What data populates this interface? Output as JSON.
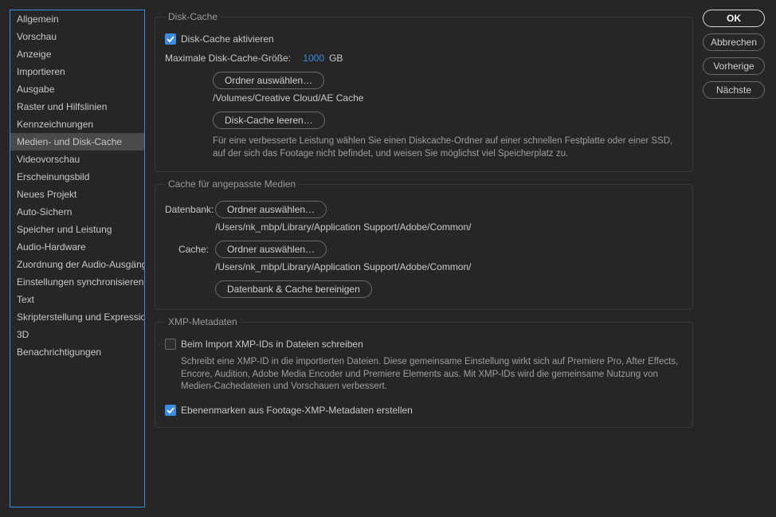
{
  "sidebar": {
    "items": [
      "Allgemein",
      "Vorschau",
      "Anzeige",
      "Importieren",
      "Ausgabe",
      "Raster und Hilfslinien",
      "Kennzeichnungen",
      "Medien- und Disk-Cache",
      "Videovorschau",
      "Erscheinungsbild",
      "Neues Projekt",
      "Auto-Sichern",
      "Speicher und Leistung",
      "Audio-Hardware",
      "Zuordnung der Audio-Ausgänge",
      "Einstellungen synchronisieren",
      "Text",
      "Skripterstellung und Expressions",
      "3D",
      "Benachrichtigungen"
    ],
    "selected_index": 7
  },
  "actions": {
    "ok": "OK",
    "cancel": "Abbrechen",
    "prev": "Vorherige",
    "next": "Nächste"
  },
  "disk_cache": {
    "legend": "Disk-Cache",
    "enable_label": "Disk-Cache aktivieren",
    "enable_checked": true,
    "max_size_label": "Maximale Disk-Cache-Größe:",
    "max_size_value": "1000",
    "max_size_unit": "GB",
    "choose_folder": "Ordner auswählen…",
    "folder_path": "/Volumes/Creative Cloud/AE Cache",
    "empty_cache": "Disk-Cache leeren…",
    "desc": "Für eine verbesserte Leistung wählen Sie einen Diskcache-Ordner auf einer schnellen Festplatte oder einer SSD, auf der sich das Footage nicht befindet, und weisen Sie möglichst viel Speicherplatz zu."
  },
  "media_cache": {
    "legend": "Cache für angepasste Medien",
    "db_label": "Datenbank:",
    "cache_label": "Cache:",
    "choose_folder": "Ordner auswählen…",
    "db_path": "/Users/nk_mbp/Library/Application Support/Adobe/Common/",
    "cache_path": "/Users/nk_mbp/Library/Application Support/Adobe/Common/",
    "clean_db_cache": "Datenbank & Cache bereinigen"
  },
  "xmp": {
    "legend": "XMP-Metadaten",
    "write_label": "Beim Import XMP-IDs in Dateien schreiben",
    "write_checked": false,
    "write_desc": "Schreibt eine XMP-ID in die importierten Dateien. Diese gemeinsame Einstellung wirkt sich auf Premiere Pro, After Effects, Encore, Audition, Adobe Media Encoder und Premiere Elements aus. Mit XMP-IDs wird die gemeinsame Nutzung von Medien-Cachedateien und Vorschauen verbessert.",
    "layer_markers_label": "Ebenenmarken aus Footage-XMP-Metadaten erstellen",
    "layer_markers_checked": true
  }
}
